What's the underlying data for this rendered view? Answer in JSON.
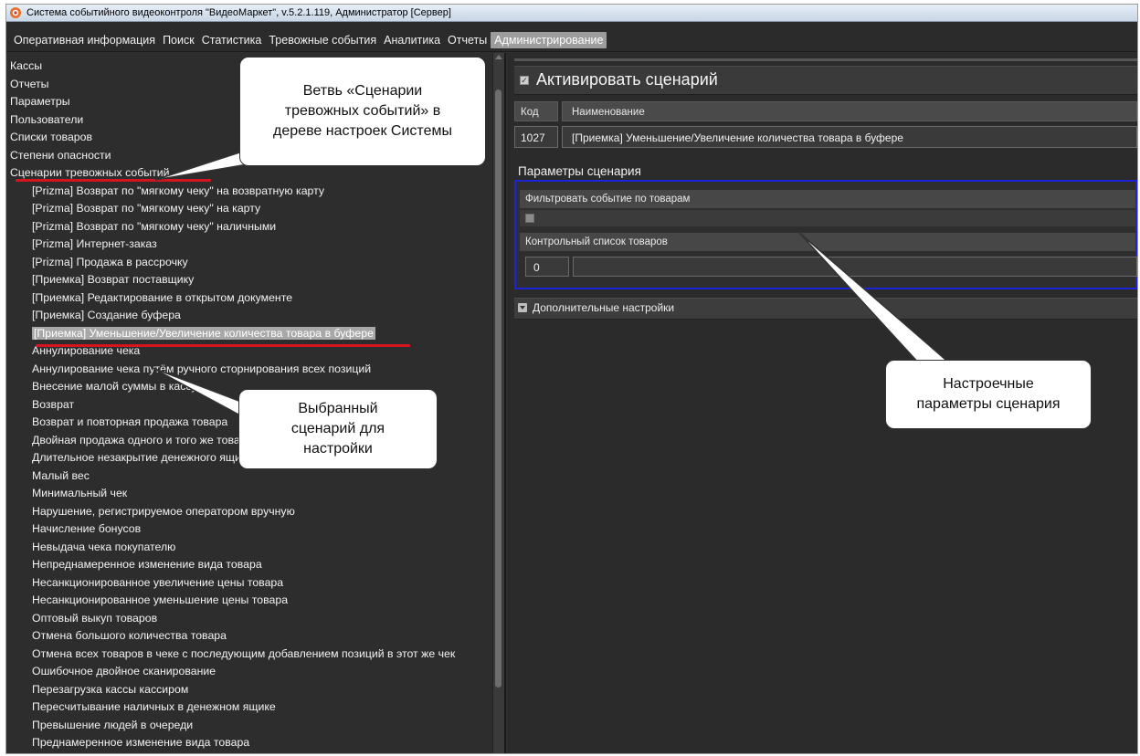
{
  "window": {
    "title": "Система событийного видеоконтроля \"ВидеоМаркет\", v.5.2.1.119, Администратор  [Сервер]"
  },
  "menu": [
    "Оперативная информация",
    "Поиск",
    "Статистика",
    "Тревожные события",
    "Аналитика",
    "Отчеты",
    "Администрирование"
  ],
  "menu_active_index": 6,
  "tree": {
    "root_items": [
      "Кассы",
      "Отчеты",
      "Параметры",
      "Пользователи",
      "Списки товаров",
      "Степени опасности",
      "Сценарии тревожных событий"
    ],
    "scenarios": [
      "[Prizma] Возврат по \"мягкому чеку\" на возвратную карту",
      "[Prizma] Возврат по \"мягкому чеку\" на карту",
      "[Prizma] Возврат по \"мягкому чеку\" наличными",
      "[Prizma] Интернет-заказ",
      "[Prizma] Продажа в рассрочку",
      "[Приемка] Возврат поставщику",
      "[Приемка] Редактирование в открытом документе",
      "[Приемка] Создание буфера",
      "[Приемка] Уменьшение/Увеличение количества товара в буфере",
      "Аннулирование чека",
      "Аннулирование чека путём ручного сторнирования всех позиций",
      "Внесение малой суммы в кассу",
      "Возврат",
      "Возврат и повторная продажа товара",
      "Двойная продажа одного и того же товара",
      "Длительное незакрытие денежного ящика",
      "Малый вес",
      "Минимальный чек",
      "Нарушение, регистрируемое оператором вручную",
      "Начисление бонусов",
      "Невыдача чека покупателю",
      "Непреднамеренное изменение вида товара",
      "Несанкционированное увеличение цены товара",
      "Несанкционированное уменьшение цены товара",
      "Оптовый выкуп товаров",
      "Отмена большого количества товара",
      "Отмена всех товаров в чеке с последующим добавлением позиций в этот же чек",
      "Ошибочное двойное сканирование",
      "Перезагрузка кассы кассиром",
      "Пересчитывание наличных в денежном ящике",
      "Превышение людей в очереди",
      "Преднамеренное изменение вида товара"
    ],
    "selected_index": 8
  },
  "scenario": {
    "activate_label": "Активировать сценарий",
    "activate_checked": true,
    "code_header": "Код",
    "name_header": "Наименование",
    "code": "1027",
    "name": "[Приемка] Уменьшение/Увеличение количества товара в буфере",
    "params_title": "Параметры сценария",
    "filter_label": "Фильтровать событие по товарам",
    "filter_checked": false,
    "control_list_label": "Контрольный список товаров",
    "control_list_code": "0",
    "control_list_name": "",
    "advanced_label": "Дополнительные настройки"
  },
  "annotations": {
    "branch_callout": "Ветвь «Сценарии\nтревожных событий» в\nдереве настроек Системы",
    "selected_callout": "Выбранный\nсценарий для\nнастройки",
    "params_callout": "Настроечные\nпараметры сценария",
    "highlight_color": "#d4141f",
    "params_box_color": "#1c24d6"
  }
}
